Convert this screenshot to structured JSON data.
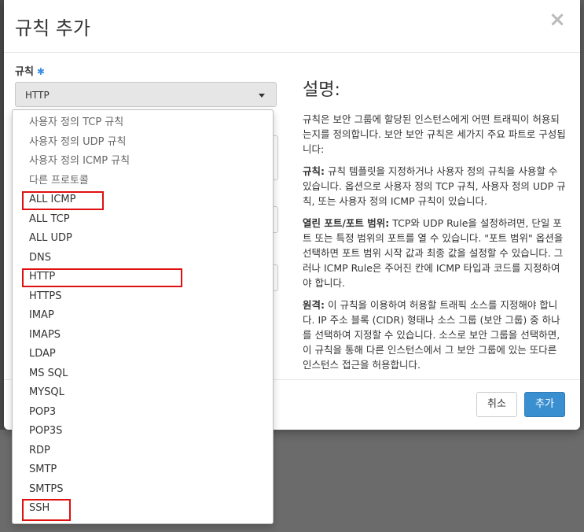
{
  "modal": {
    "title": "규칙 추가",
    "close_glyph": "×"
  },
  "rule_field": {
    "label": "규칙",
    "required_mark": "✱",
    "selected_value": "HTTP"
  },
  "dropdown": {
    "options": [
      "사용자 정의 TCP 규칙",
      "사용자 정의 UDP 규칙",
      "사용자 정의 ICMP 규칙",
      "다른 프로토콜",
      "ALL ICMP",
      "ALL TCP",
      "ALL UDP",
      "DNS",
      "HTTP",
      "HTTPS",
      "IMAP",
      "IMAPS",
      "LDAP",
      "MS SQL",
      "MYSQL",
      "POP3",
      "POP3S",
      "RDP",
      "SMTP",
      "SMTPS",
      "SSH"
    ],
    "highlighted": [
      "ALL ICMP",
      "HTTP",
      "SSH"
    ],
    "highlight_color": "#e01010"
  },
  "description": {
    "heading": "설명:",
    "intro": "규칙은 보안 그룹에 할당된 인스턴스에게 어떤 트래픽이 허용되는지를 정의합니다. 보안 보안 규칙은 세가지 주요 파트로 구성됩니다:",
    "rule_term": "규칙:",
    "rule_text": " 규칙 템플릿을 지정하거나 사용자 정의 규칙을 사용할 수 있습니다. 옵션으로 사용자 정의 TCP 규칙, 사용자 정의 UDP 규칙, 또는 사용자 정의 ICMP 규칙이 있습니다.",
    "port_term": "열린 포트/포트 범위:",
    "port_text": " TCP와 UDP Rule을 설정하려면, 단일 포트 또는 특정 범위의 포트를 열 수 있습니다. \"포트 범위\" 옵션을 선택하면 포트 범위 시작 값과 최종 값을 설정할 수 있습니다. 그러나 ICMP Rule은 주어진 칸에 ICMP 타입과 코드를 지정하여야 합니다.",
    "remote_term": "원격:",
    "remote_text": " 이 규칙을 이용하여 허용할 트래픽 소스를 지정해야 합니다. IP 주소 블록 (CIDR) 형태나 소스 그룹 (보안 그룹) 중 하나를 선택하여 지정할 수 있습니다. 소스로 보안 그룹을 선택하면, 이 규칙을 통해 다른 인스턴스에서 그 보안 그룹에 있는 또다른 인스턴스 접근을 허용합니다."
  },
  "footer": {
    "cancel_label": "취소",
    "add_label": "추가"
  },
  "colors": {
    "primary_button": "#3a8fd1",
    "required_star": "#3a8ee6"
  }
}
